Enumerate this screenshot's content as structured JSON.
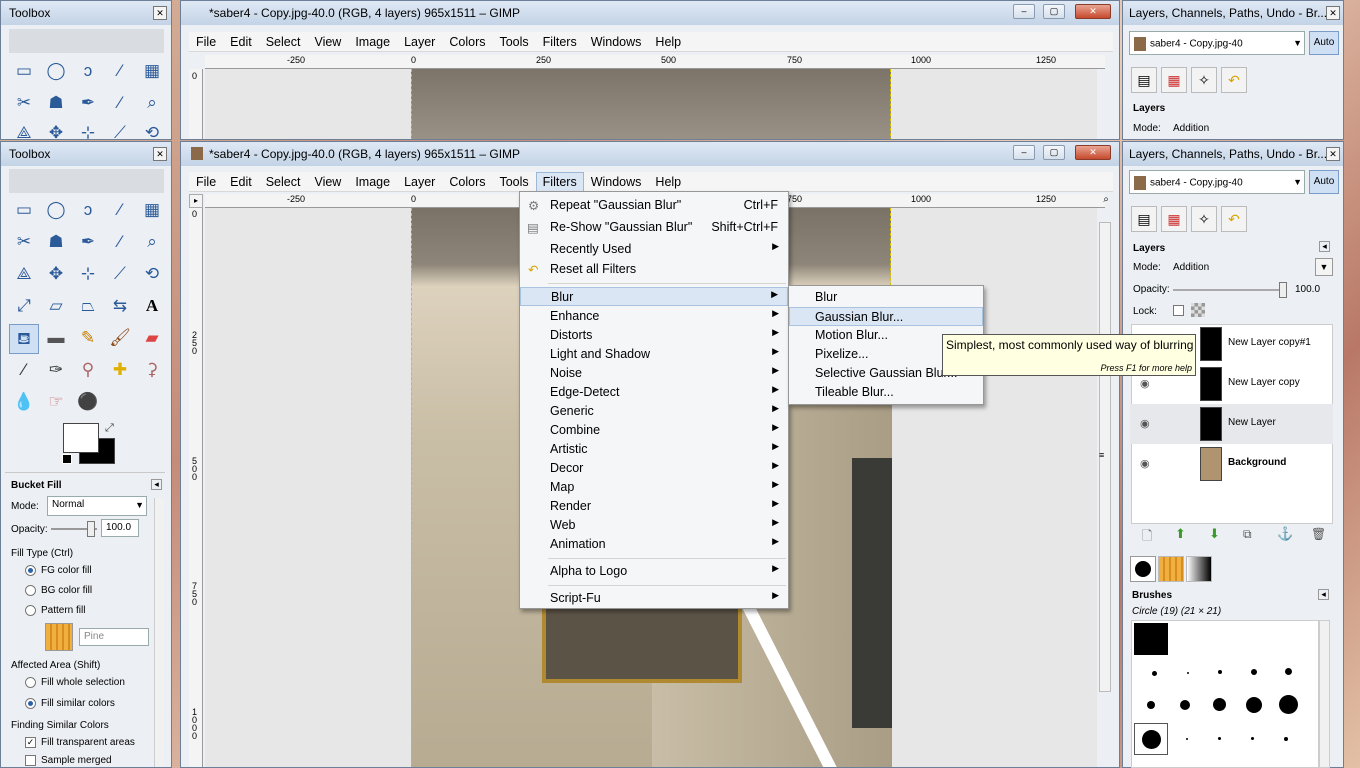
{
  "toolbox_top": {
    "title": "Toolbox"
  },
  "toolbox": {
    "title": "Toolbox",
    "options_title": "Bucket Fill",
    "mode_label": "Mode:",
    "mode_value": "Normal",
    "opacity_label": "Opacity:",
    "opacity_value": "100.0",
    "fill_type_label": "Fill Type  (Ctrl)",
    "fill_types": [
      "FG color fill",
      "BG color fill",
      "Pattern fill"
    ],
    "pattern_name": "Pine",
    "affected_area_label": "Affected Area  (Shift)",
    "affected_areas": [
      "Fill whole selection",
      "Fill similar colors"
    ],
    "finding_label": "Finding Similar Colors",
    "finding_options": [
      "Fill transparent areas",
      "Sample merged"
    ]
  },
  "image_window_top": {
    "title": "*saber4 - Copy.jpg-40.0 (RGB, 4 layers) 965x1511 – GIMP",
    "menu": [
      "File",
      "Edit",
      "Select",
      "View",
      "Image",
      "Layer",
      "Colors",
      "Tools",
      "Filters",
      "Windows",
      "Help"
    ],
    "ruler": [
      "-250",
      "0",
      "250",
      "500",
      "750",
      "1000",
      "1250"
    ],
    "vruler_top": "0"
  },
  "image_window": {
    "title": "*saber4 - Copy.jpg-40.0 (RGB, 4 layers) 965x1511 – GIMP",
    "menu": [
      "File",
      "Edit",
      "Select",
      "View",
      "Image",
      "Layer",
      "Colors",
      "Tools",
      "Filters",
      "Windows",
      "Help"
    ],
    "ruler": [
      "-250",
      "0",
      "250",
      "500",
      "750",
      "1000",
      "1250"
    ],
    "vruler": [
      "0",
      "2\n5\n0",
      "5\n0\n0",
      "7\n5\n0",
      "1\n0\n0\n0"
    ]
  },
  "filters_menu": {
    "repeat": {
      "label": "Repeat \"Gaussian Blur\"",
      "shortcut": "Ctrl+F"
    },
    "reshow": {
      "label": "Re-Show \"Gaussian Blur\"",
      "shortcut": "Shift+Ctrl+F"
    },
    "recently_used": "Recently Used",
    "reset": "Reset all Filters",
    "items": [
      "Blur",
      "Enhance",
      "Distorts",
      "Light and Shadow",
      "Noise",
      "Edge-Detect",
      "Generic",
      "Combine",
      "Artistic",
      "Decor",
      "Map",
      "Render",
      "Web",
      "Animation"
    ],
    "alpha_to_logo": "Alpha to Logo",
    "script_fu": "Script-Fu"
  },
  "blur_submenu": {
    "items": [
      "Blur",
      "Gaussian Blur...",
      "Motion Blur...",
      "Pixelize...",
      "Selective Gaussian Blur...",
      "Tileable Blur..."
    ]
  },
  "tooltip": {
    "text": "Simplest, most commonly used way of blurring",
    "help": "Press F1 for more help"
  },
  "layers_dock_top": {
    "title": "Layers, Channels, Paths, Undo - Br...",
    "image_select": "saber4 - Copy.jpg-40",
    "auto": "Auto",
    "section": "Layers",
    "mode_label": "Mode:",
    "mode_value": "Addition"
  },
  "layers_dock": {
    "title": "Layers, Channels, Paths, Undo - Br...",
    "image_select": "saber4 - Copy.jpg-40",
    "auto": "Auto",
    "section": "Layers",
    "mode_label": "Mode:",
    "mode_value": "Addition",
    "opacity_label": "Opacity:",
    "opacity_value": "100.0",
    "lock_label": "Lock:",
    "layers": [
      "New Layer copy#1",
      "New Layer copy",
      "New Layer",
      "Background"
    ],
    "brushes_title": "Brushes",
    "brush_name": "Circle (19) (21 × 21)"
  },
  "colors": {
    "accent": "#2d62a6",
    "highlight": "#dbe6f4",
    "tooltip_bg": "#ffffe1"
  }
}
